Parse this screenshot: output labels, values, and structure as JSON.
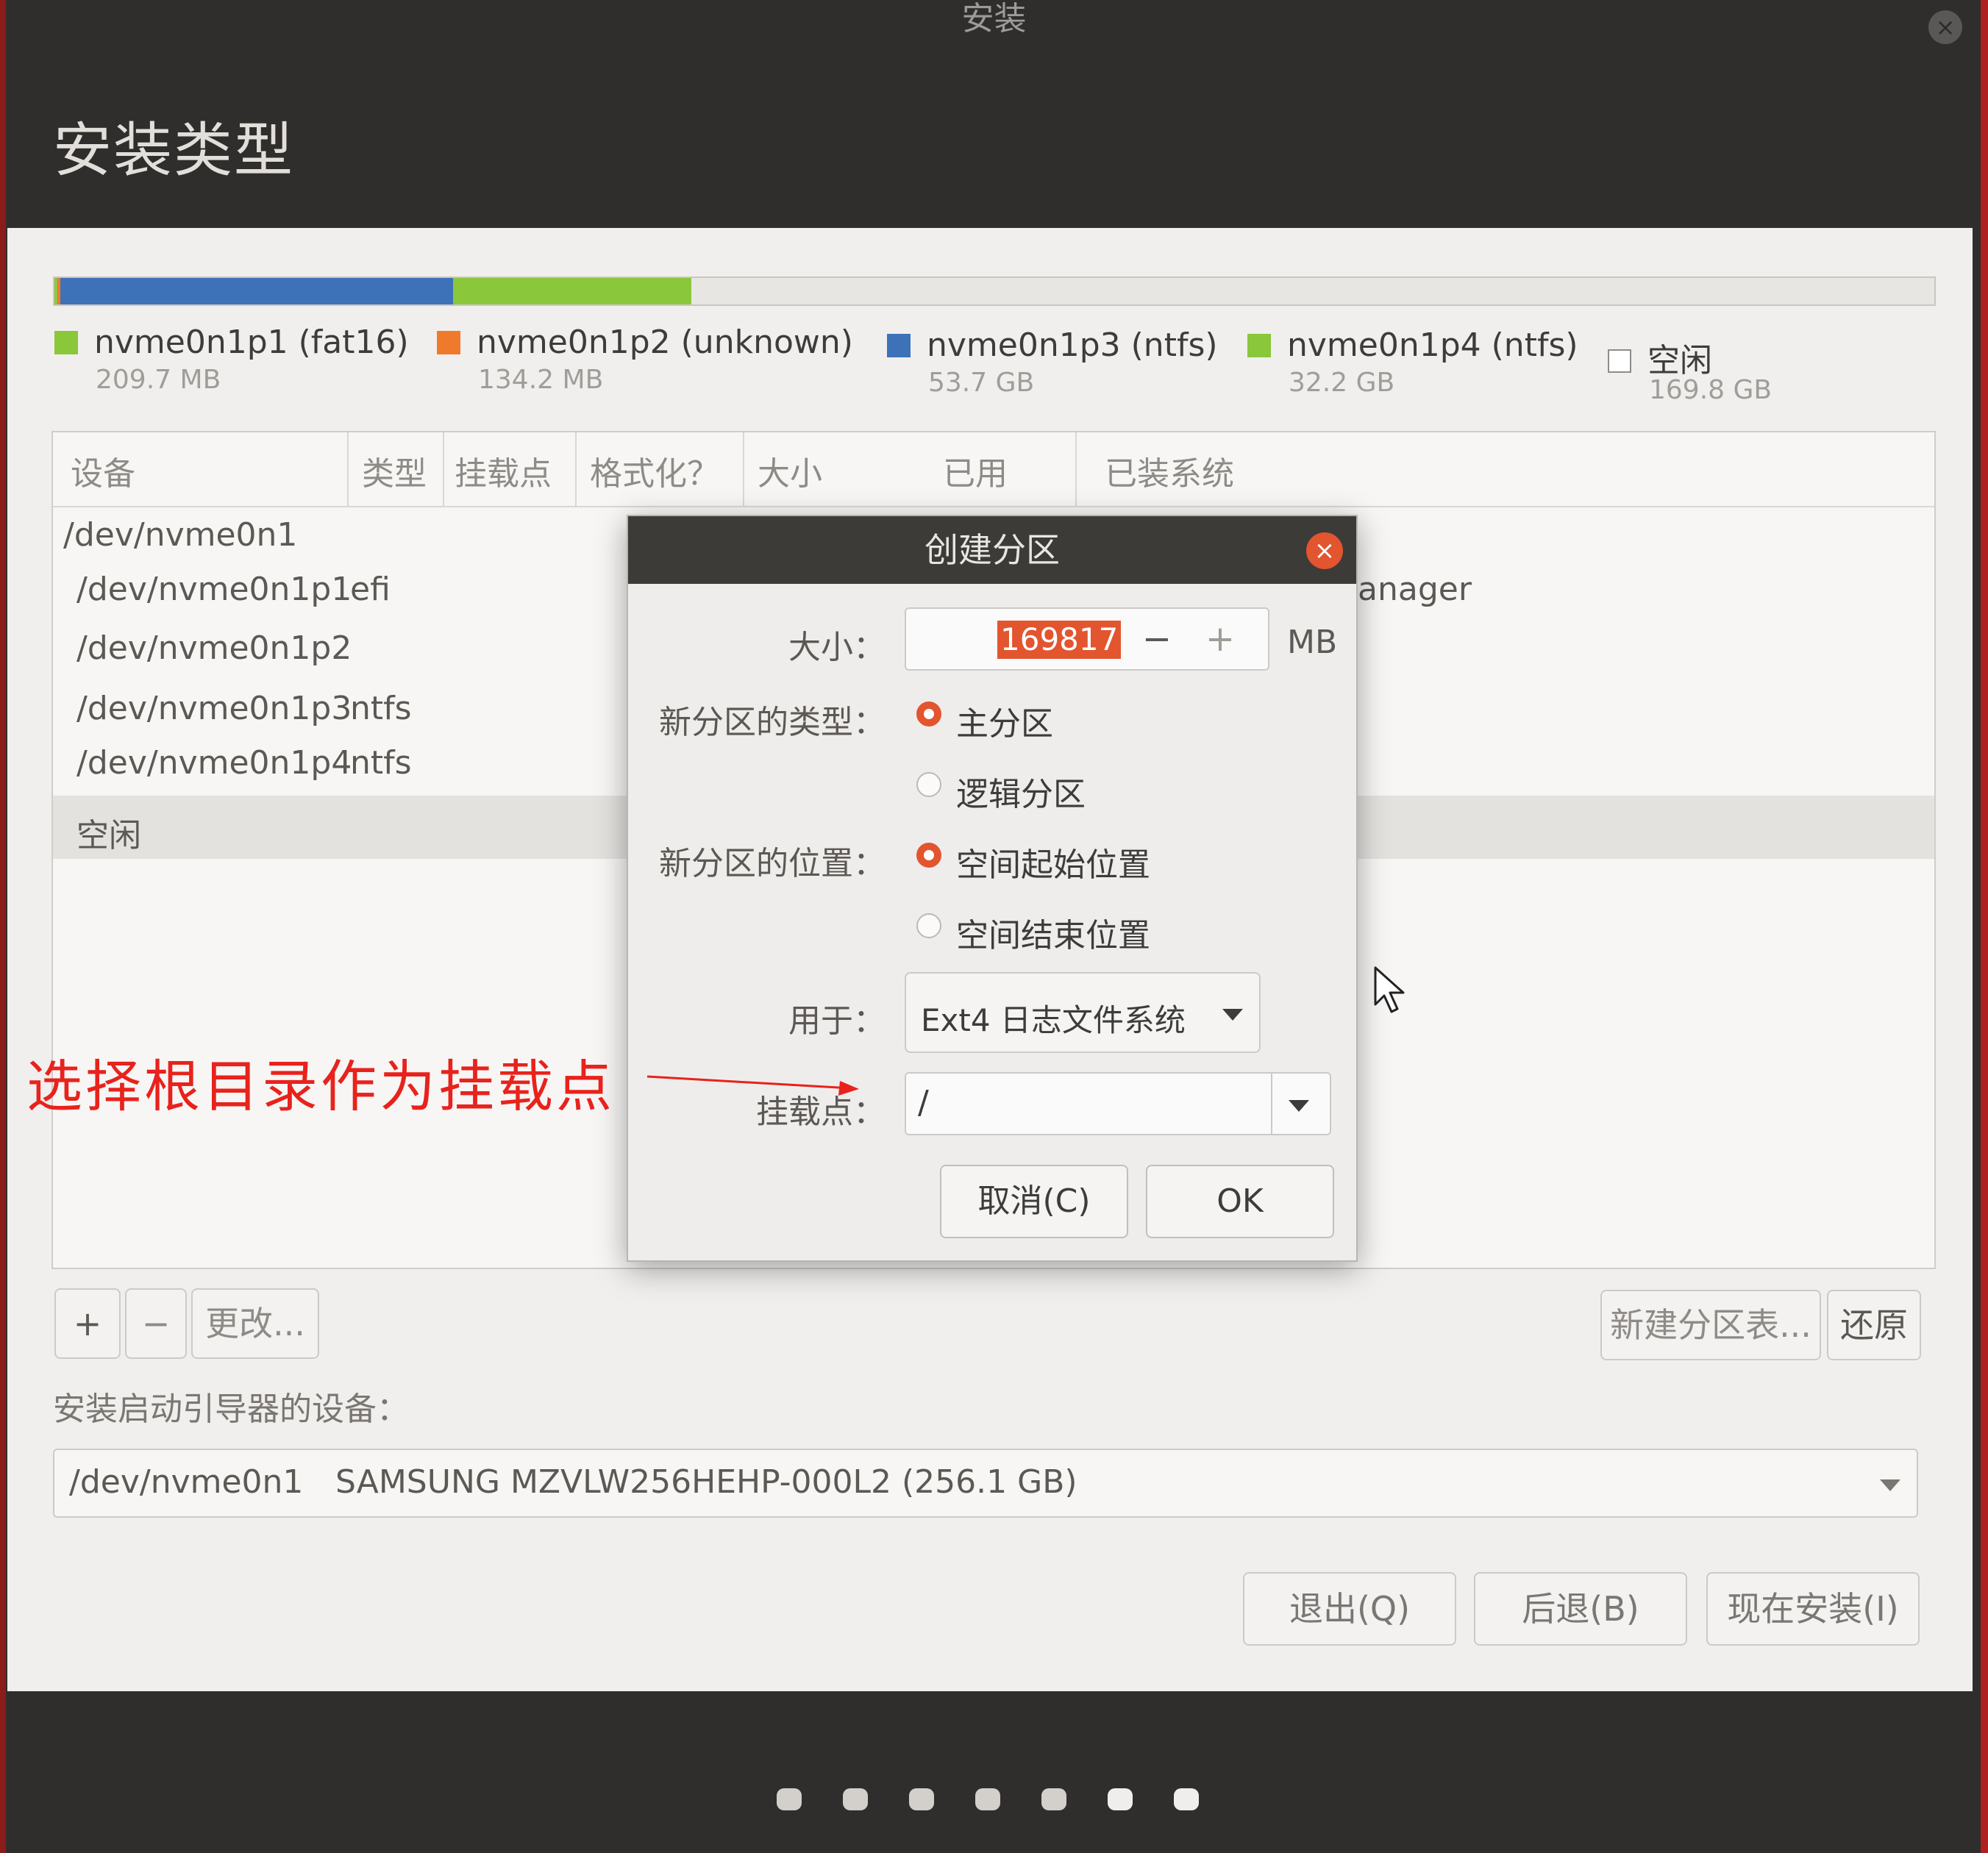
{
  "window": {
    "title": "安装",
    "page_title": "安装类型"
  },
  "colors": {
    "accent": "#e2552f",
    "partition_green": "#8ac73a",
    "partition_orange": "#ef7a2c",
    "partition_blue": "#3d71b8",
    "annotation_red": "#e8221c"
  },
  "partitions": [
    {
      "name": "nvme0n1p1 (fat16)",
      "size": "209.7 MB",
      "color": "#8ac73a"
    },
    {
      "name": "nvme0n1p2 (unknown)",
      "size": "134.2 MB",
      "color": "#ef7a2c"
    },
    {
      "name": "nvme0n1p3 (ntfs)",
      "size": "53.7 GB",
      "color": "#3d71b8"
    },
    {
      "name": "nvme0n1p4 (ntfs)",
      "size": "32.2 GB",
      "color": "#8ac73a"
    },
    {
      "name": "空闲",
      "size": "169.8 GB",
      "color": "#ffffff"
    }
  ],
  "table": {
    "headers": [
      "设备",
      "类型",
      "挂载点",
      "格式化？",
      "大小",
      "已用",
      "已装系统"
    ],
    "rows": [
      {
        "device": "/dev/nvme0n1",
        "type": ""
      },
      {
        "device": "/dev/nvme0n1p1",
        "type": "efi"
      },
      {
        "device": "/dev/nvme0n1p2",
        "type": ""
      },
      {
        "device": "/dev/nvme0n1p3",
        "type": "ntfs"
      },
      {
        "device": "/dev/nvme0n1p4",
        "type": "ntfs"
      },
      {
        "device": "空闲",
        "type": ""
      }
    ],
    "partial_text": "anager"
  },
  "toolbar": {
    "add": "+",
    "remove": "−",
    "change": "更改...",
    "new_table": "新建分区表...",
    "revert": "还原"
  },
  "boot": {
    "label": "安装启动引导器的设备：",
    "device": "/dev/nvme0n1",
    "description": "SAMSUNG MZVLW256HEHP-000L2 (256.1 GB)"
  },
  "nav": {
    "quit": "退出(Q)",
    "back": "后退(B)",
    "install": "现在安装(I)"
  },
  "dialog": {
    "title": "创建分区",
    "size_label": "大小：",
    "size_value": "169817",
    "size_unit": "MB",
    "minus": "−",
    "plus": "+",
    "type_label": "新分区的类型：",
    "type_primary": "主分区",
    "type_logical": "逻辑分区",
    "location_label": "新分区的位置：",
    "location_start": "空间起始位置",
    "location_end": "空间结束位置",
    "use_label": "用于：",
    "use_value": "Ext4 日志文件系统",
    "mount_label": "挂载点：",
    "mount_value": "/",
    "cancel": "取消(C)",
    "ok": "OK"
  },
  "annotation": "选择根目录作为挂载点"
}
